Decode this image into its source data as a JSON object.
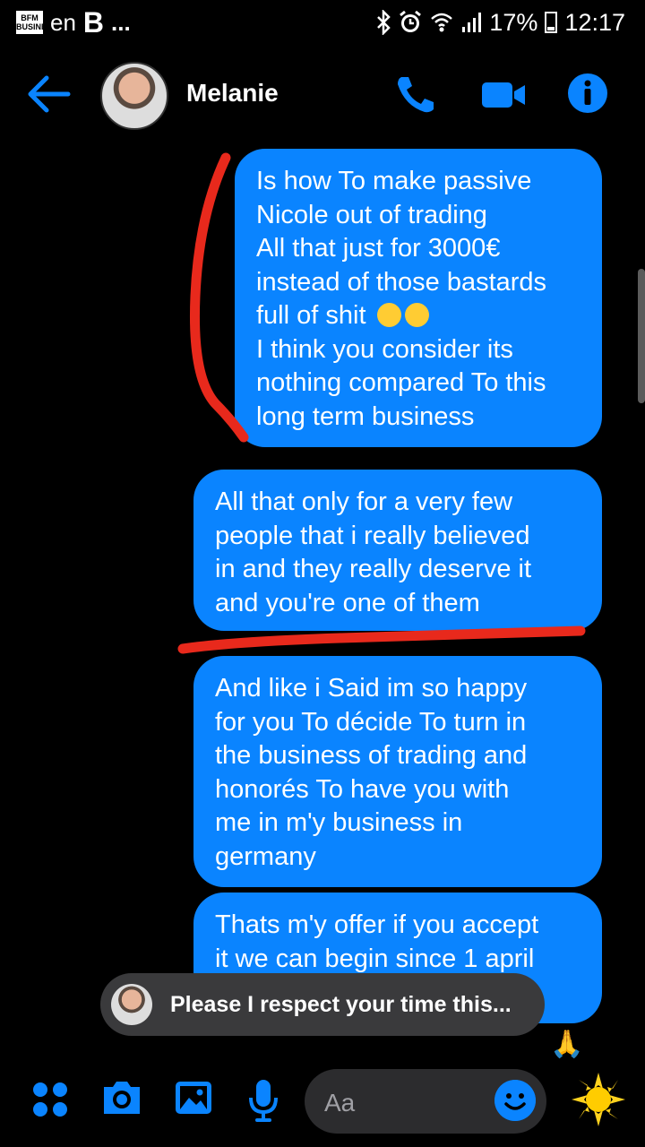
{
  "status_bar": {
    "logo_text": "BFM BUSINESS",
    "left_text_1": "en",
    "left_text_2": "B",
    "left_text_3": "...",
    "battery": "17%",
    "time": "12:17"
  },
  "header": {
    "contact_name": "Melanie",
    "back_icon": "arrow-left-icon",
    "call_icon": "phone-icon",
    "video_icon": "video-camera-icon",
    "info_icon": "info-icon"
  },
  "messages": [
    {
      "text_before": "Is how To make passive\nNicole out of trading\nAll that just for 3000€\ninstead of those bastards\nfull of shit",
      "emojis": [
        "hugging-face",
        "expressionless-face"
      ],
      "text_after": "\nI think you consider its\nnothing compared To this\nlong term business"
    },
    {
      "text": "All that only for a very few\npeople that i really believed\nin and they really deserve it\nand you're one of them"
    },
    {
      "text": "And like i Said im so happy\nfor you To décide To turn in\nthe business of trading and\nhonorés To have you with\nme in m'y business in\ngermany"
    },
    {
      "text": "Thats m'y offer if you accept\nit we can begin since 1 april"
    }
  ],
  "new_message_pill": {
    "text": "Please I respect your time this..."
  },
  "composer": {
    "placeholder": "Aa",
    "icons": [
      "apps-grid-icon",
      "camera-icon",
      "image-icon",
      "microphone-icon",
      "smile-icon",
      "sun-emoji-icon"
    ]
  },
  "colors": {
    "bubble": "#0a84ff",
    "accent": "#0a84ff",
    "annotation": "#e8291c",
    "background": "#000000"
  }
}
